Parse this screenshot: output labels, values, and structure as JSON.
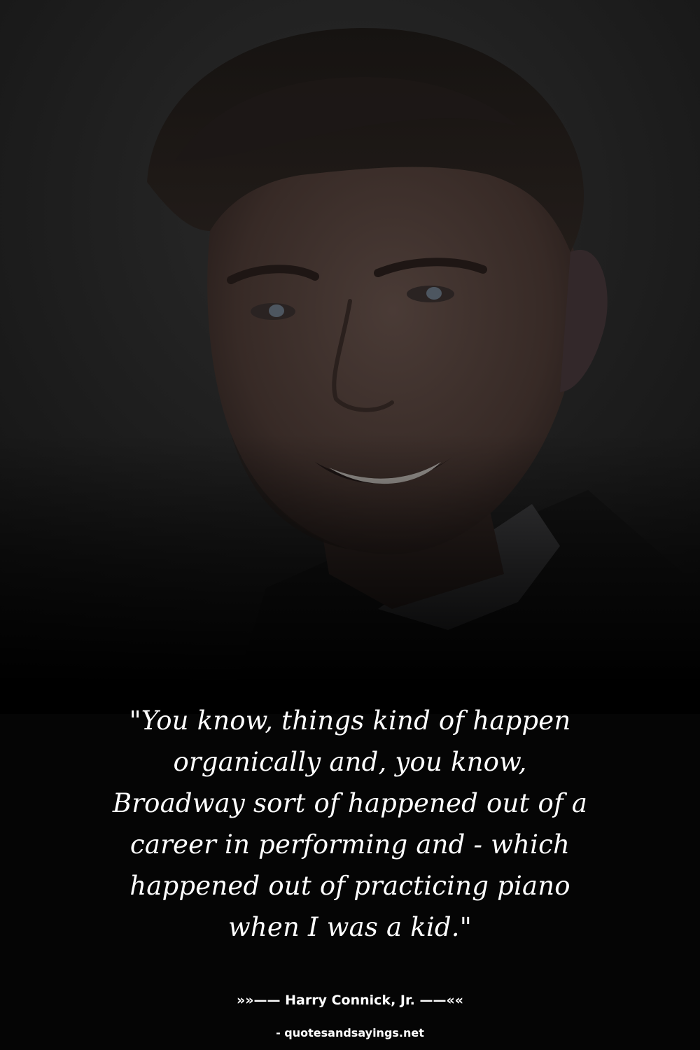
{
  "quote": {
    "lines": [
      "\"You know, things kind of happen",
      "organically and, you know,",
      "Broadway sort of happened out of a",
      "career in performing and - which",
      "happened out of practicing piano",
      "when I was a kid.\""
    ]
  },
  "attribution": {
    "author_line": "»»—— Harry Connick, Jr. ——««"
  },
  "footer": {
    "source": "- quotesandsayings.net"
  },
  "photo": {
    "subject": "portrait of a smiling man in a suit"
  },
  "colors": {
    "background": "#050505",
    "text": "#ffffff"
  }
}
